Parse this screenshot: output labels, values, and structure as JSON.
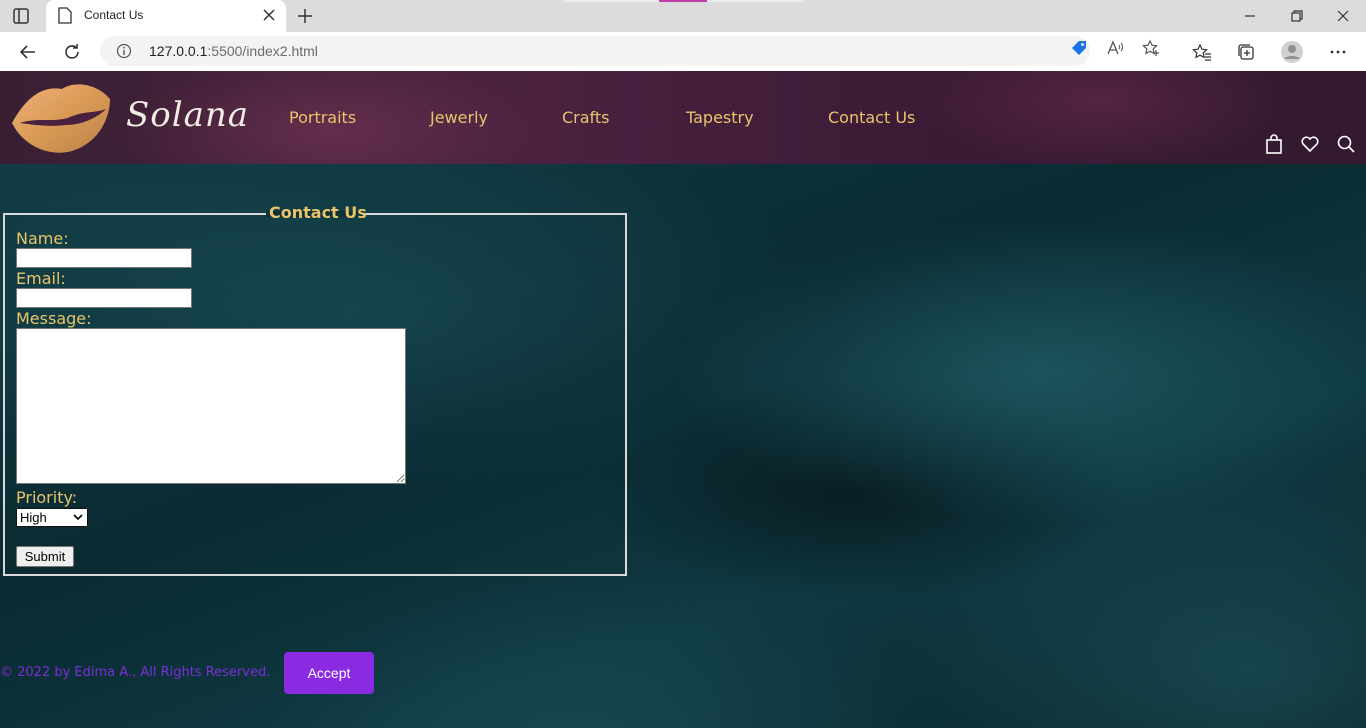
{
  "browser": {
    "tab_title": "Contact Us",
    "url_host": "127.0.0.1",
    "url_rest": ":5500/index2.html"
  },
  "site": {
    "logo_text": "Solana",
    "nav": [
      "Portraits",
      "Jewerly",
      "Crafts",
      "Tapestry",
      "Contact Us"
    ],
    "colors": {
      "accent": "#e8c56a",
      "footer": "#7b2fd6",
      "button": "#8a2be2"
    }
  },
  "form": {
    "legend": "Contact Us",
    "name_label": "Name:",
    "name_value": "",
    "email_label": "Email:",
    "email_value": "",
    "message_label": "Message:",
    "message_value": "",
    "priority_label": "Priority:",
    "priority_selected": "High",
    "submit_label": "Submit"
  },
  "footer": {
    "copyright": "© 2022 by Edima A., All Rights Reserved.",
    "accept_label": "Accept"
  }
}
